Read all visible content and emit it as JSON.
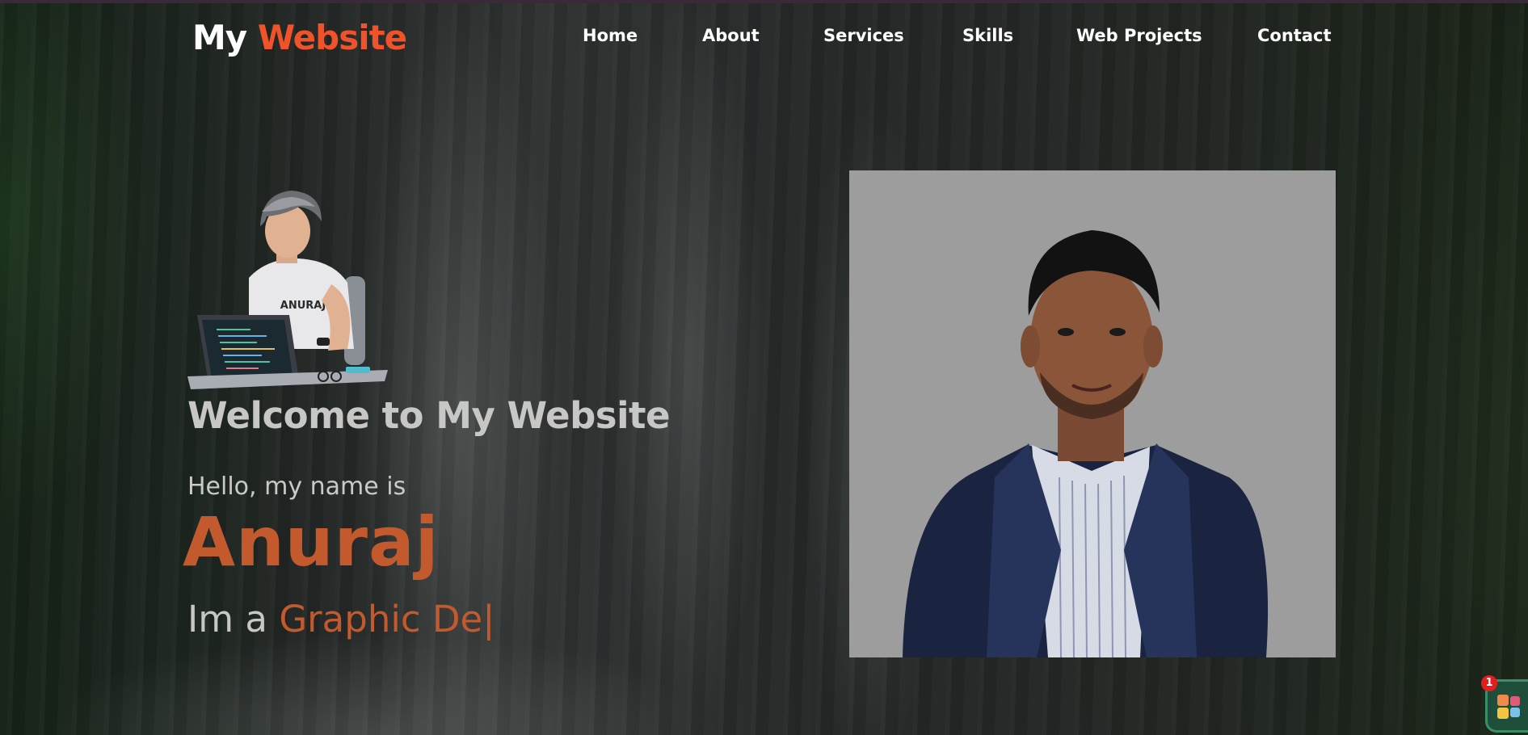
{
  "header": {
    "logo_main": "My",
    "logo_accent": "Website"
  },
  "nav": {
    "items": [
      {
        "label": "Home",
        "name": "nav-home"
      },
      {
        "label": "About",
        "name": "nav-about"
      },
      {
        "label": "Services",
        "name": "nav-services"
      },
      {
        "label": "Skills",
        "name": "nav-skills"
      },
      {
        "label": "Web Projects",
        "name": "nav-web-projects"
      },
      {
        "label": "Contact",
        "name": "nav-contact"
      }
    ]
  },
  "hero": {
    "welcome": "Welcome to My Website",
    "greeting": "Hello, my name is",
    "name": "Anuraj",
    "role_prefix": "Im a",
    "role_typed": "Graphic De",
    "cursor": "|",
    "avatar_shirt_text": "ANURAJ"
  },
  "widget": {
    "badge_count": "1"
  },
  "colors": {
    "accent": "#f0532a",
    "name_color": "#c25a2e",
    "text_light": "#c7c7c5",
    "photo_bg": "#9d9d9d"
  },
  "icons": {
    "widget": "extension-widget-icon"
  }
}
